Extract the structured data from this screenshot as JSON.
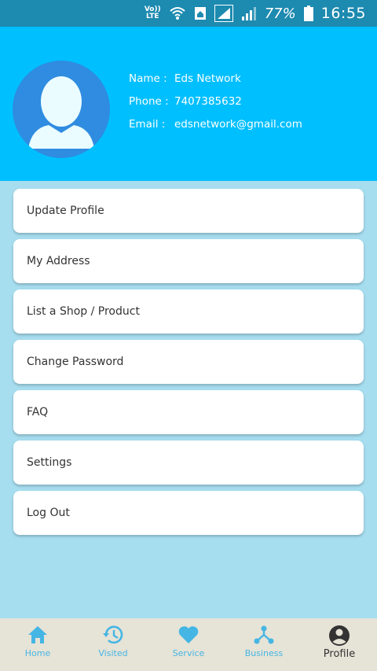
{
  "status_bar": {
    "volte_top": "Vo))",
    "volte_bottom": "LTE",
    "battery": "77%",
    "time": "16:55"
  },
  "profile": {
    "name_label": "Name :",
    "name_value": "Eds Network",
    "phone_label": "Phone :",
    "phone_value": "7407385632",
    "email_label": "Email :",
    "email_value": "edsnetwork@gmail.com"
  },
  "menu": {
    "items": [
      {
        "label": "Update Profile"
      },
      {
        "label": "My Address"
      },
      {
        "label": "List a Shop / Product"
      },
      {
        "label": "Change Password"
      },
      {
        "label": "FAQ"
      },
      {
        "label": "Settings"
      },
      {
        "label": "Log Out"
      }
    ]
  },
  "bottom_nav": {
    "items": [
      {
        "label": "Home",
        "icon": "home-icon"
      },
      {
        "label": "Visited",
        "icon": "history-icon"
      },
      {
        "label": "Service",
        "icon": "heart-icon"
      },
      {
        "label": "Business",
        "icon": "network-icon"
      },
      {
        "label": "Profile",
        "icon": "account-circle-icon",
        "active": true
      }
    ]
  },
  "colors": {
    "status_bar": "#1d8ab0",
    "header": "#00bfff",
    "background": "#a6ddef",
    "nav_background": "#e6e3d7",
    "nav_accent": "#45b6e4",
    "avatar_bg": "#2f8ce0"
  }
}
